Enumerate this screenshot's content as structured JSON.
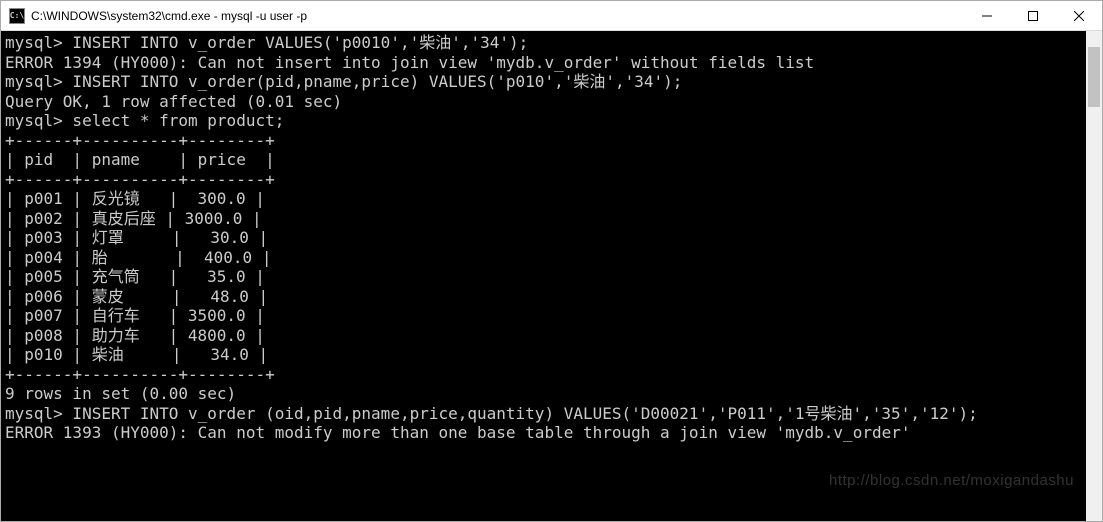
{
  "titlebar": {
    "icon_text": "C:\\",
    "title": "C:\\WINDOWS\\system32\\cmd.exe - mysql  -u user -p"
  },
  "terminal": {
    "blank0": "",
    "line1": "mysql> INSERT INTO v_order VALUES('p0010','柴油','34');",
    "line2": "ERROR 1394 (HY000): Can not insert into join view 'mydb.v_order' without fields list",
    "line3": "mysql> INSERT INTO v_order(pid,pname,price) VALUES('p010','柴油','34');",
    "line4": "Query OK, 1 row affected (0.01 sec)",
    "blank1": "",
    "line5": "mysql> select * from product;",
    "tbl_border_top": "+------+----------+--------+",
    "tbl_header": "| pid  | pname    | price  |",
    "tbl_border_mid": "+------+----------+--------+",
    "r1": "| p001 | 反光镜   |  300.0 |",
    "r2": "| p002 | 真皮后座 | 3000.0 |",
    "r3": "| p003 | 灯罩     |   30.0 |",
    "r4": "| p004 | 胎       |  400.0 |",
    "r5": "| p005 | 充气筒   |   35.0 |",
    "r6": "| p006 | 蒙皮     |   48.0 |",
    "r7": "| p007 | 自行车   | 3500.0 |",
    "r8": "| p008 | 助力车   | 4800.0 |",
    "r9": "| p010 | 柴油     |   34.0 |",
    "tbl_border_bot": "+------+----------+--------+",
    "line6": "9 rows in set (0.00 sec)",
    "blank2": "",
    "line7": "mysql> INSERT INTO v_order (oid,pid,pname,price,quantity) VALUES('D00021','P011','1号柴油','35','12');",
    "line8": "ERROR 1393 (HY000): Can not modify more than one base table through a join view 'mydb.v_order'"
  },
  "chart_data": {
    "type": "table",
    "title": "product",
    "columns": [
      "pid",
      "pname",
      "price"
    ],
    "rows": [
      {
        "pid": "p001",
        "pname": "反光镜",
        "price": 300.0
      },
      {
        "pid": "p002",
        "pname": "真皮后座",
        "price": 3000.0
      },
      {
        "pid": "p003",
        "pname": "灯罩",
        "price": 30.0
      },
      {
        "pid": "p004",
        "pname": "胎",
        "price": 400.0
      },
      {
        "pid": "p005",
        "pname": "充气筒",
        "price": 35.0
      },
      {
        "pid": "p006",
        "pname": "蒙皮",
        "price": 48.0
      },
      {
        "pid": "p007",
        "pname": "自行车",
        "price": 3500.0
      },
      {
        "pid": "p008",
        "pname": "助力车",
        "price": 4800.0
      },
      {
        "pid": "p010",
        "pname": "柴油",
        "price": 34.0
      }
    ],
    "row_count_text": "9 rows in set (0.00 sec)"
  },
  "watermark": "http://blog.csdn.net/moxigandashu"
}
